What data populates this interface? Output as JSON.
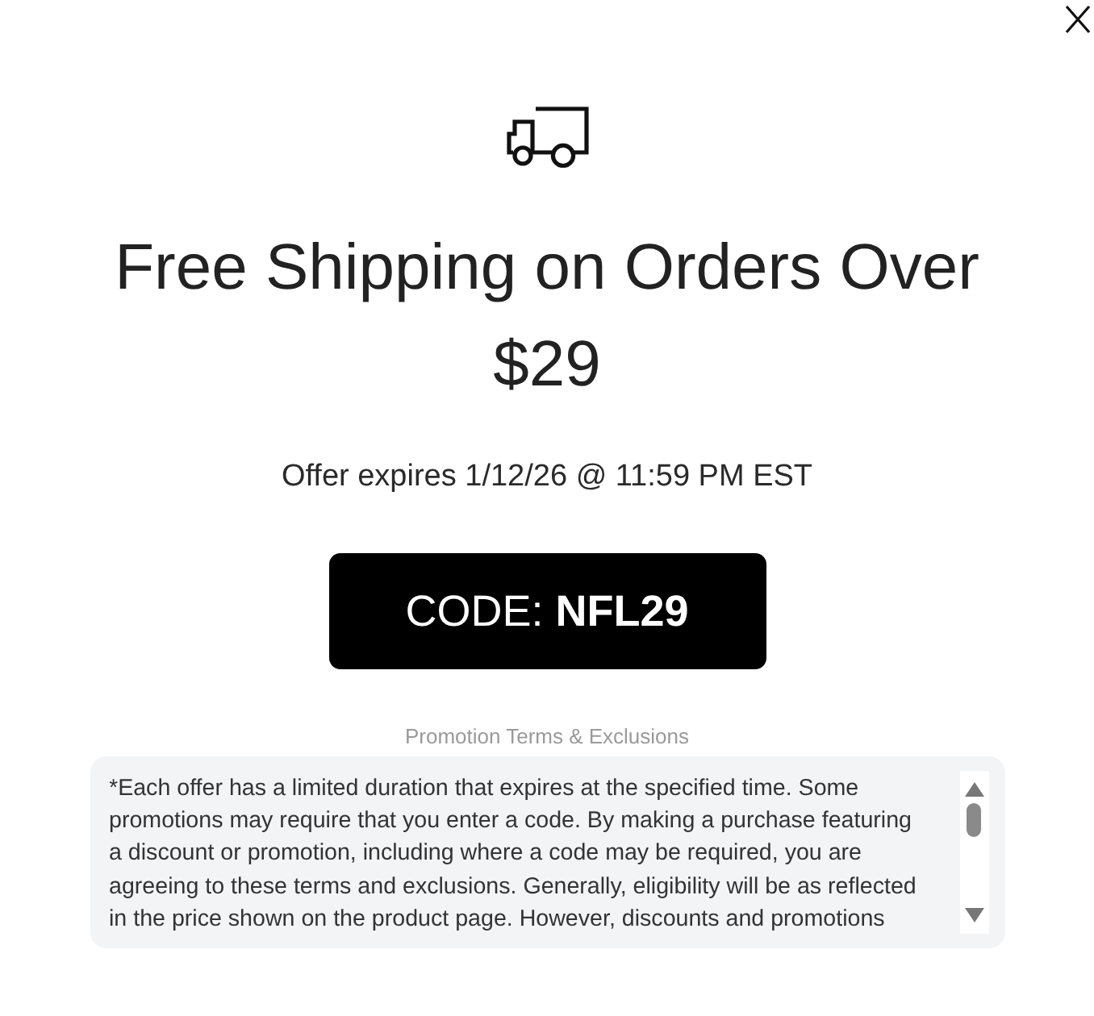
{
  "offer": {
    "title": "Free Shipping on Orders Over $29",
    "expiry": "Offer expires 1/12/26 @ 11:59 PM EST",
    "code_button": "CODE: **NFL29**"
  },
  "terms": {
    "heading": "Promotion Terms & Exclusions",
    "text": "*Each offer has a limited duration that expires at the specified time. Some promotions may require that you enter a code. By making a purchase featuring a discount or promotion, including where a code may be required, you are agreeing to these terms and exclusions. Generally, eligibility will be as reflected in the price shown on the product page. However, discounts and promotions"
  }
}
